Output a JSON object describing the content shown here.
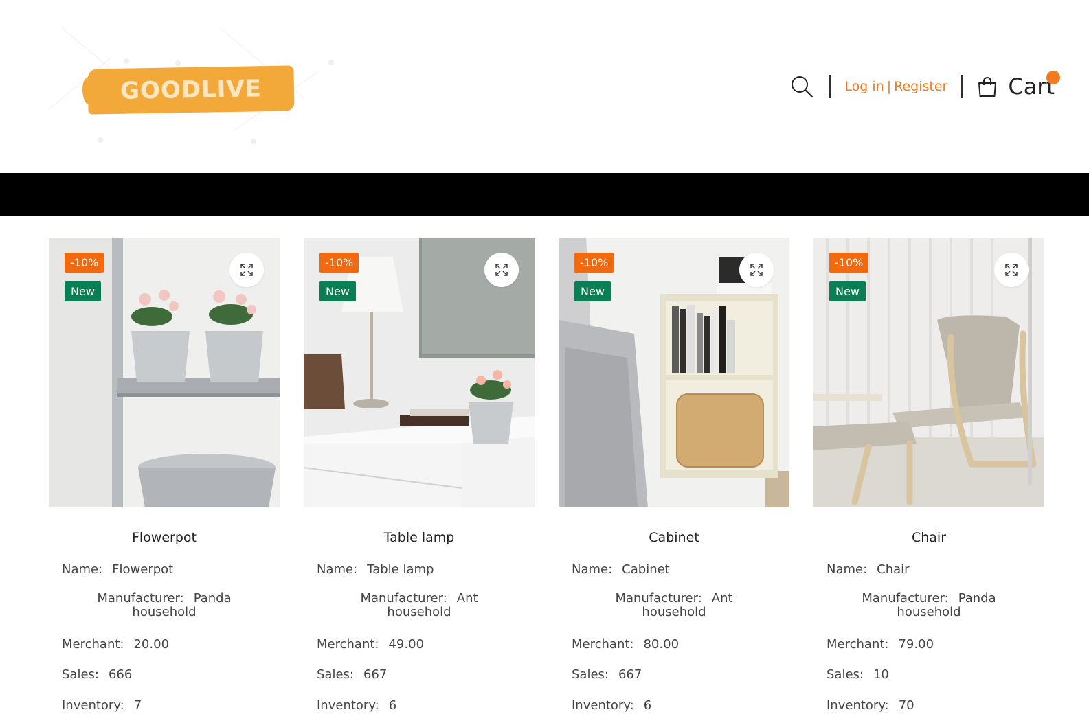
{
  "header": {
    "logo_text": "GOODLIVE",
    "login_label": "Log in",
    "separator": "|",
    "register_label": "Register",
    "cart_label": "Cart"
  },
  "labels": {
    "name": "Name:",
    "manufacturer": "Manufacturer:",
    "merchant": "Merchant:",
    "sales": "Sales:",
    "inventory": "Inventory:"
  },
  "colors": {
    "accent": "#f07b22",
    "sale_badge": "#f26a10",
    "new_badge": "#0a7f56",
    "band": "#000000",
    "logo": "#f3a83a"
  },
  "products": [
    {
      "title": "Flowerpot",
      "discount": "-10%",
      "badge": "New",
      "name": "Flowerpot",
      "manufacturer_line1": "Panda",
      "manufacturer_line2": "household",
      "merchant": "20.00",
      "sales": "666",
      "inventory": "7"
    },
    {
      "title": "Table lamp",
      "discount": "-10%",
      "badge": "New",
      "name": "Table lamp",
      "manufacturer_line1": "Ant",
      "manufacturer_line2": "household",
      "merchant": "49.00",
      "sales": "667",
      "inventory": "6"
    },
    {
      "title": "Cabinet",
      "discount": "-10%",
      "badge": "New",
      "name": "Cabinet",
      "manufacturer_line1": "Ant",
      "manufacturer_line2": "household",
      "merchant": "80.00",
      "sales": "667",
      "inventory": "6"
    },
    {
      "title": "Chair",
      "discount": "-10%",
      "badge": "New",
      "name": "Chair",
      "manufacturer_line1": "Panda",
      "manufacturer_line2": "household",
      "merchant": "79.00",
      "sales": "10",
      "inventory": "70"
    }
  ]
}
